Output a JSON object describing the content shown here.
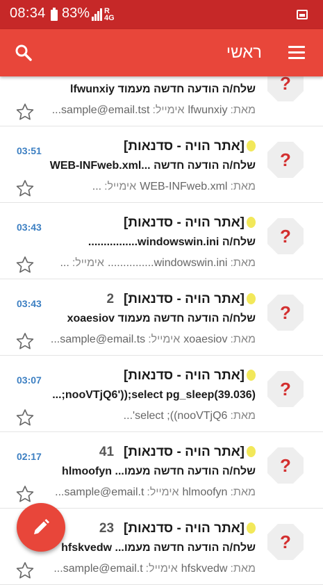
{
  "status_bar": {
    "time": "08:34",
    "battery": "83%",
    "network_r": "R",
    "network_4g": "4G"
  },
  "app_bar": {
    "title": "ראשי"
  },
  "emails": [
    {
      "time": "",
      "subject": "",
      "count": "",
      "line2": "שלח/ה הודעה חדשה מעמוד lfwunxiy",
      "from_label": "מאת:",
      "from_value": "lfwunxiy",
      "email_label": "אימייל:",
      "email_value": "sample@email.tst..."
    },
    {
      "time": "03:51",
      "subject": "[אתר הויה - סדנאות]",
      "count": "",
      "line2": "שלח/ה הודעה חדשה ...WEB-INFweb.xml",
      "from_label": "מאת:",
      "from_value": "WEB-INFweb.xml",
      "email_label": "אימייל:",
      "email_value": "..."
    },
    {
      "time": "03:43",
      "subject": "[אתר הויה - סדנאות]",
      "count": "",
      "line2": "שלח/ה windowswin.ini................",
      "from_label": "מאת:",
      "from_value": "windowswin.ini...............",
      "email_label": "אימייל:",
      "email_value": "..."
    },
    {
      "time": "03:43",
      "subject": "[אתר הויה - סדנאות]",
      "count": "2",
      "line2": "שלח/ה הודעה חדשה מעמוד xoaesiov",
      "from_label": "מאת:",
      "from_value": "xoaesiov",
      "email_label": "אימייל:",
      "email_value": "sample@email.ts..."
    },
    {
      "time": "03:07",
      "subject": "[אתר הויה - סדנאות]",
      "count": "",
      "line2": "nooVTjQ6'));select pg_sleep(39.036);...",
      "from_label": "מאת:",
      "from_value": "select ;((nooVTjQ6'...",
      "email_label": "",
      "email_value": ""
    },
    {
      "time": "02:17",
      "subject": "[אתר הויה - סדנאות]",
      "count": "41",
      "line2": "שלח/ה הודעה חדשה מעמו... hlmoofyn",
      "from_label": "מאת:",
      "from_value": "hlmoofyn",
      "email_label": "אימייל:",
      "email_value": "sample@email.t..."
    },
    {
      "time": "",
      "subject": "[אתר הויה - סדנאות]",
      "count": "23",
      "line2": "שלח/ה הודעה חדשה מעמו... hfskvedw",
      "from_label": "מאת:",
      "from_value": "hfskvedw",
      "email_label": "אימייל:",
      "email_value": "sample@email.t..."
    }
  ],
  "icons": {
    "search": "search-icon",
    "menu": "menu-icon",
    "star": "star-outline-icon",
    "unknown_sender": "question-octagon-icon",
    "compose": "pencil-icon"
  },
  "colors": {
    "status_bar": "#c62828",
    "app_bar": "#e8463a",
    "time_text": "#3c7fc2",
    "badge_bg": "#eeeeee",
    "badge_mark": "#d32f2f",
    "label_moon": "#f2e85a"
  }
}
